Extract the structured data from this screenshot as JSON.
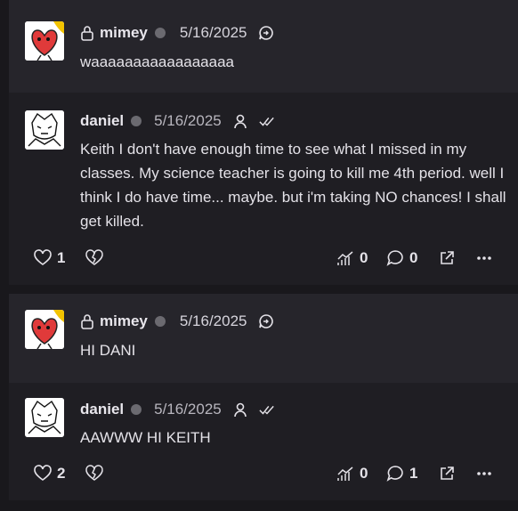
{
  "posts": [
    {
      "parent": {
        "author": "mimey",
        "date": "5/16/2025",
        "text": "waaaaaaaaaaaaaaaaa"
      },
      "reply": {
        "author": "daniel",
        "date": "5/16/2025",
        "text": "Keith I don't have enough time to see what I missed in my classes. My science teacher is going to kill me 4th period. well I think I do have time... maybe. but i'm taking NO chances! I shall get killed.",
        "likes": "1",
        "stats": "0",
        "comments": "0"
      }
    },
    {
      "parent": {
        "author": "mimey",
        "date": "5/16/2025",
        "text": "HI DANI"
      },
      "reply": {
        "author": "daniel",
        "date": "5/16/2025",
        "text": "AAWWW HI KEITH",
        "likes": "2",
        "stats": "0",
        "comments": "1"
      }
    }
  ],
  "icons": {
    "lock": "lock-icon",
    "status": "status-dot",
    "reply": "reply-bubble-icon",
    "user": "user-icon",
    "read": "double-check-icon",
    "like": "heart-icon",
    "broken": "broken-heart-icon",
    "stats": "stats-icon",
    "comment": "comment-icon",
    "share": "share-icon",
    "more": "more-icon"
  },
  "colors": {
    "background": "#19181c",
    "card_top": "#26252b",
    "card_bottom": "#1f1e23",
    "avatar_mimey": "#e03a3a"
  }
}
